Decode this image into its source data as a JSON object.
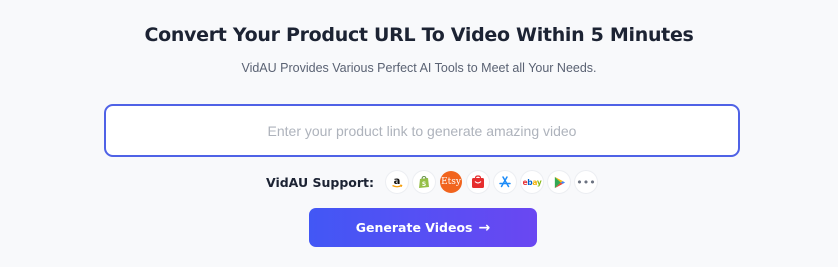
{
  "header": {
    "title": "Convert Your Product URL To Video Within 5 Minutes",
    "subtitle": "VidAU Provides Various Perfect AI Tools to Meet all Your Needs."
  },
  "input": {
    "value": "",
    "placeholder": "Enter your product link to generate amazing video"
  },
  "support": {
    "label": "VidAU Support:",
    "platforms": [
      {
        "name": "amazon-icon"
      },
      {
        "name": "shopify-icon"
      },
      {
        "name": "etsy-icon",
        "text": "Etsy"
      },
      {
        "name": "aliexpress-icon"
      },
      {
        "name": "app-store-icon"
      },
      {
        "name": "ebay-icon",
        "text": "ebay"
      },
      {
        "name": "google-play-icon"
      },
      {
        "name": "more-icon",
        "text": "•••"
      }
    ]
  },
  "cta": {
    "label": "Generate Videos",
    "arrow": "→"
  },
  "colors": {
    "accent": "#4f62e6",
    "button_start": "#4257f5",
    "button_end": "#6a47f2",
    "etsy": "#f1641e",
    "ali": "#e62e2e"
  }
}
